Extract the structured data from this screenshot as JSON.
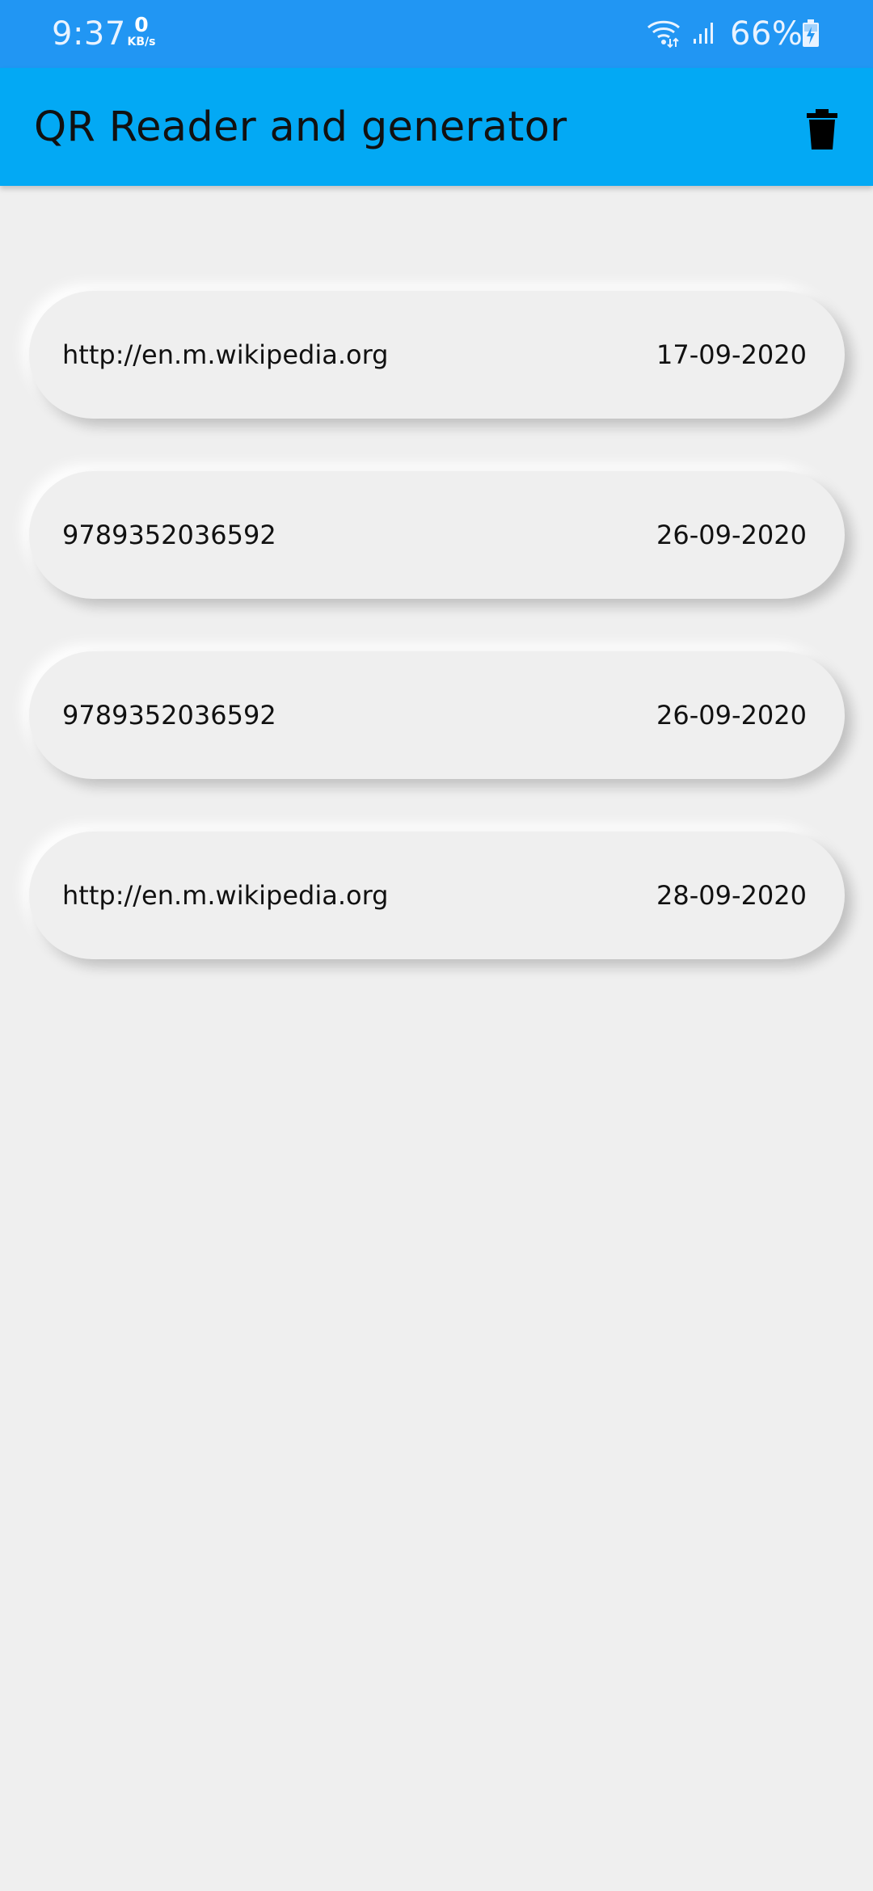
{
  "status_bar": {
    "time": "9:37",
    "net_speed_value": "0",
    "net_speed_unit": "KB/s",
    "battery_percent": "66%",
    "icons": [
      "wifi-icon",
      "signal-icon",
      "battery-charging-icon"
    ]
  },
  "app_bar": {
    "title": "QR Reader and generator",
    "delete_icon": "trash-icon"
  },
  "history": [
    {
      "content": "http://en.m.wikipedia.org",
      "date": "17-09-2020"
    },
    {
      "content": "9789352036592",
      "date": "26-09-2020"
    },
    {
      "content": "9789352036592",
      "date": "26-09-2020"
    },
    {
      "content": "http://en.m.wikipedia.org",
      "date": "28-09-2020"
    }
  ],
  "colors": {
    "status_bar": "#2196f3",
    "app_bar": "#03a9f4",
    "background": "#efefef"
  }
}
